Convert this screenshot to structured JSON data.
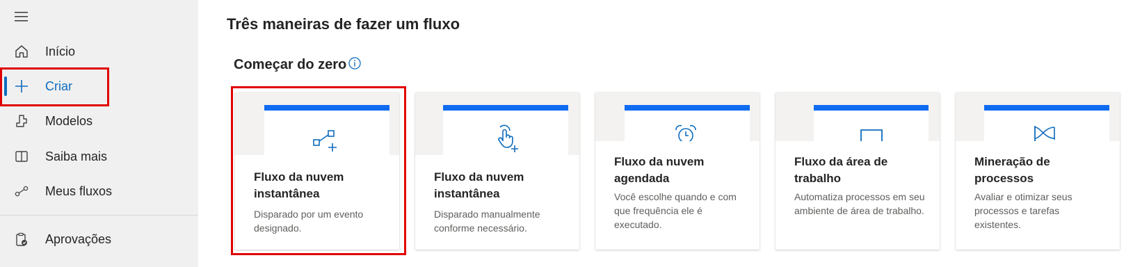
{
  "sidebar": {
    "items": [
      {
        "label": "Início",
        "icon": "home-icon"
      },
      {
        "label": "Criar",
        "icon": "plus-icon",
        "active": true
      },
      {
        "label": "Modelos",
        "icon": "templates-icon"
      },
      {
        "label": "Saiba mais",
        "icon": "book-icon"
      },
      {
        "label": "Meus fluxos",
        "icon": "flows-icon"
      },
      {
        "label": "Aprovações",
        "icon": "approvals-icon"
      }
    ]
  },
  "main": {
    "title": "Três maneiras de fazer um fluxo",
    "section_title": "Começar do zero",
    "cards": [
      {
        "title": "Fluxo da nuvem instantânea",
        "description": "Disparado por um evento designado.",
        "icon": "flow-connector-icon"
      },
      {
        "title": "Fluxo da nuvem instantânea",
        "description": "Disparado manualmente conforme necessário.",
        "icon": "touch-hand-icon"
      },
      {
        "title": "Fluxo da nuvem agendada",
        "description": "Você escolhe quando e com que frequência ele é executado.",
        "icon": "alarm-clock-icon"
      },
      {
        "title": "Fluxo da área de trabalho",
        "description": "Automatiza processos em seu ambiente de área de trabalho.",
        "icon": "desktop-icon"
      },
      {
        "title": "Mineração de processos",
        "description": "Avaliar e otimizar seus processos e tarefas existentes.",
        "icon": "process-mining-icon"
      }
    ]
  },
  "colors": {
    "accent": "#0f6cbd",
    "card_bar": "#0f6cf0",
    "highlight": "#e00000",
    "sidebar_bg": "#f0f0f0"
  }
}
